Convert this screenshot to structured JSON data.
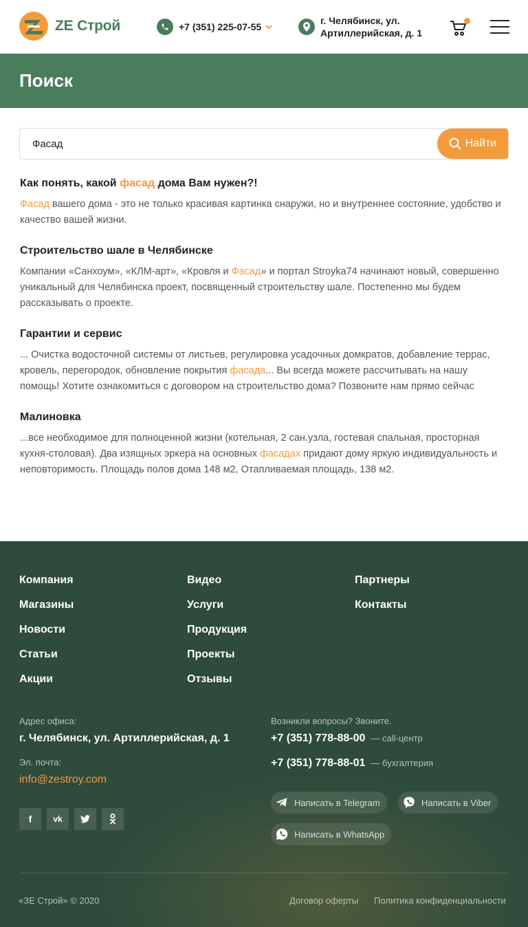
{
  "header": {
    "brand": "ZE Строй",
    "phone": "+7 (351) 225-07-55",
    "address": "г. Челябинск, ул. Артиллерийская, д. 1",
    "icons": [
      "phone-icon",
      "chevron-down-icon",
      "map-pin-icon",
      "cart-icon",
      "menu-icon"
    ],
    "colors": {
      "brand_green": "#4a7d5c",
      "accent_orange": "#f39b3a"
    }
  },
  "page": {
    "title": "Поиск"
  },
  "search": {
    "value": "Фасад",
    "button_label": "Найти"
  },
  "results": [
    {
      "title_parts": [
        "Как понять, какой ",
        "фасад",
        " дома Вам нужен?!"
      ],
      "text_parts": [
        "",
        "Фасад",
        " вашего дома - это не только красивая картинка снаружи, но и внутреннее состояние, удобство и качество вашей жизни."
      ]
    },
    {
      "title": "Строительство шале в Челябинске",
      "text_parts": [
        "Компании «Санхоум», «КЛМ-арт», «Кровля и ",
        "Фасад",
        "» и портал Stroyka74 начинают новый, совершенно уникальный для Челябинска проект, посвященный строительству шале. Постепенно мы будем рассказывать о проекте."
      ]
    },
    {
      "title": "Гарантии и сервис",
      "text_parts": [
        "... Очистка водосточной системы от листьев, регулировка усадочных домкратов, добавление террас, кровель, перегородок, обновление покрытия ",
        "фасада",
        "... Вы всегда можете рассчитывать на нашу помощь! Хотите ознакомиться с договором на строительство дома? Позвоните нам прямо сейчас"
      ]
    },
    {
      "title": "Малиновка",
      "text_parts": [
        "...все необходимое для полноценной жизни (котельная, 2 сан.узла, гостевая спальная, просторная кухня-столовая). Два изящных эркера на основных ",
        "фасадах",
        " придают дому яркую индивидуальность и неповторимость. Площадь полов дома 148 м2, Отапливаемая площадь, 138 м2."
      ]
    }
  ],
  "footer": {
    "nav": [
      [
        "Компания",
        "Магазины",
        "Новости",
        "Статьи",
        "Акции"
      ],
      [
        "Видео",
        "Услуги",
        "Продукция",
        "Проекты",
        "Отзывы"
      ],
      [
        "Партнеры",
        "Контакты"
      ]
    ],
    "office_label": "Адрес офиса:",
    "office_address": "г. Челябинск, ул. Артиллерийская, д. 1",
    "email_label": "Эл. почта:",
    "email": "info@zestroy.com",
    "social": [
      "facebook-icon",
      "vk-icon",
      "twitter-icon",
      "odnoklassniki-icon"
    ],
    "call_label": "Возникли вопросы? Звоните.",
    "phones": [
      {
        "number": "+7 (351) 778-88-00",
        "note": "— call-центр"
      },
      {
        "number": "+7 (351) 778-88-01",
        "note": "— бухгалтерия"
      }
    ],
    "messengers": {
      "telegram": "Написать в Telegram",
      "viber": "Написать в Viber",
      "whatsapp": "Написать в WhatsApp"
    },
    "copyright": "«ЗЕ Строй» © 2020",
    "links": {
      "offer": "Договор оферты",
      "privacy": "Политика конфиденциальности"
    },
    "colors": {
      "background": "#2e4b3c"
    }
  }
}
